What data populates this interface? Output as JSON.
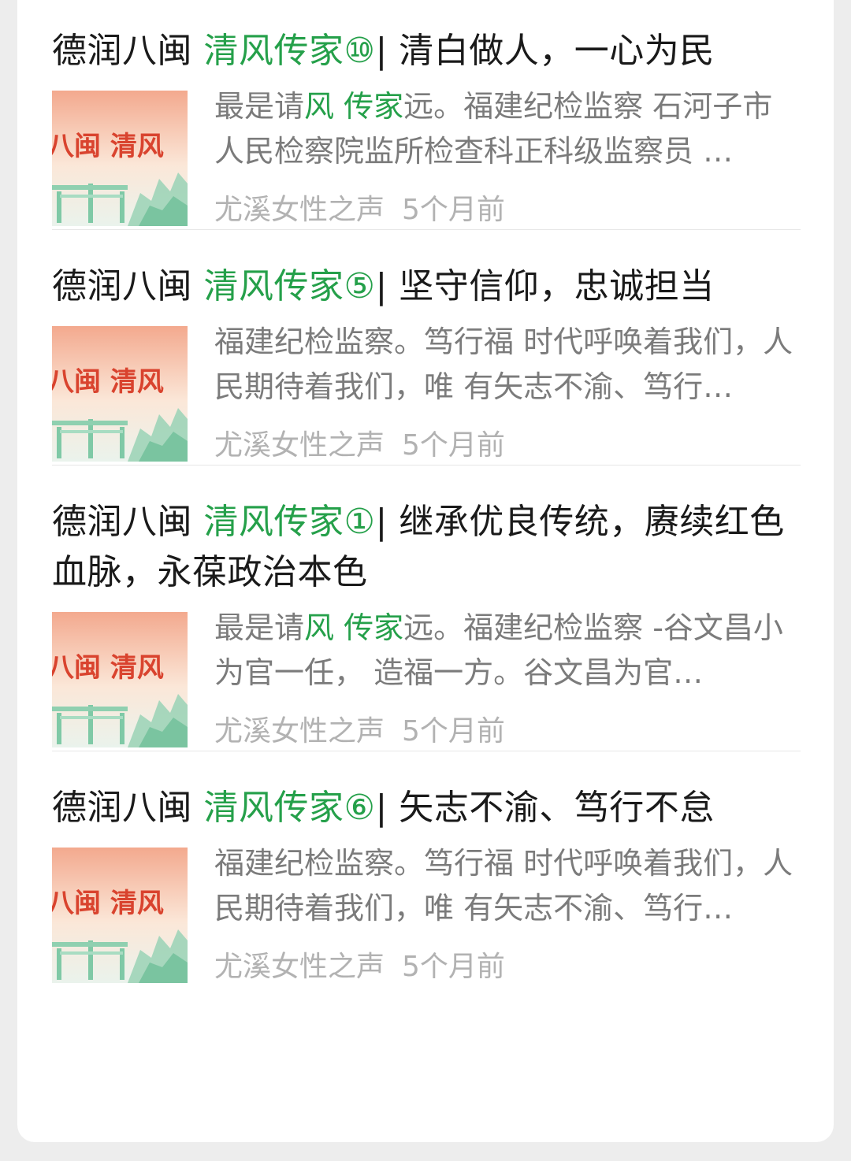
{
  "results": [
    {
      "title_prefix": "德润八闽 ",
      "title_highlight": "清风传家⑩",
      "title_suffix": "| 清白做人，一心为民",
      "snippet_a": "最是请",
      "snippet_hl1": "风",
      "snippet_b": " ",
      "snippet_hl2": "传家",
      "snippet_c": "远。福建纪检监察 石河子市人民检察院监所检查科正科级监察员 …",
      "thumb_text": "八闽 清风",
      "source": "尤溪女性之声",
      "time": "5个月前"
    },
    {
      "title_prefix": "德润八闽 ",
      "title_highlight": "清风传家⑤",
      "title_suffix": "| 坚守信仰，忠诚担当",
      "snippet_a": "福建纪检监察。笃行福 时代呼唤着我们，人民期待着我们，唯 有矢志不渝、笃行…",
      "snippet_hl1": "",
      "snippet_b": "",
      "snippet_hl2": "",
      "snippet_c": "",
      "thumb_text": "八闽 清风",
      "source": "尤溪女性之声",
      "time": "5个月前"
    },
    {
      "title_prefix": "德润八闽 ",
      "title_highlight": "清风传家①",
      "title_suffix": "| 继承优良传统，赓续红色血脉，永葆政治本色",
      "snippet_a": "最是请",
      "snippet_hl1": "风",
      "snippet_b": " ",
      "snippet_hl2": "传家",
      "snippet_c": "远。福建纪检监察 -谷文昌小 为官一任， 造福一方。谷文昌为官…",
      "thumb_text": "八闽 清风",
      "source": "尤溪女性之声",
      "time": "5个月前"
    },
    {
      "title_prefix": "德润八闽 ",
      "title_highlight": "清风传家⑥",
      "title_suffix": "| 矢志不渝、笃行不怠",
      "snippet_a": "福建纪检监察。笃行福 时代呼唤着我们，人民期待着我们，唯 有矢志不渝、笃行…",
      "snippet_hl1": "",
      "snippet_b": "",
      "snippet_hl2": "",
      "snippet_c": "",
      "thumb_text": "八闽 清风",
      "source": "尤溪女性之声",
      "time": "5个月前"
    }
  ],
  "colors": {
    "highlight": "#25a04a",
    "title": "#1a1a1a",
    "snippet": "#7b7b7b",
    "meta": "#b2b2b2"
  }
}
